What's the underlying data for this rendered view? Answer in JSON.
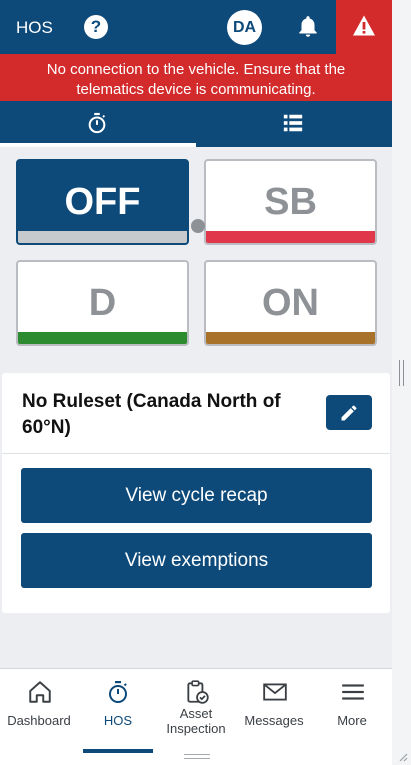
{
  "header": {
    "title": "HOS",
    "help_icon": "?",
    "avatar": "DA",
    "bell_icon": "bell-icon",
    "warning_icon": "warning-icon"
  },
  "alert": {
    "line1": "No connection to the vehicle. Ensure that the",
    "line2": "telematics device is communicating."
  },
  "tabs": [
    "stopwatch-icon",
    "list-icon"
  ],
  "statuses": [
    {
      "label": "OFF",
      "color": "#c7cacd",
      "active": true
    },
    {
      "label": "SB",
      "color": "#e0384a",
      "active": false
    },
    {
      "label": "D",
      "color": "#2c8a2f",
      "active": false
    },
    {
      "label": "ON",
      "color": "#a9722a",
      "active": false
    }
  ],
  "ruleset": {
    "line1": "No Ruleset (Canada North of",
    "line2": "60°N)"
  },
  "actions": {
    "cycle_recap": "View cycle recap",
    "exemptions": "View exemptions"
  },
  "nav": {
    "dashboard": "Dashboard",
    "hos": "HOS",
    "asset_inspection_1": "Asset",
    "asset_inspection_2": "Inspection",
    "messages": "Messages",
    "more": "More"
  },
  "colors": {
    "primary": "#0d4a7a",
    "alert": "#d32a2b"
  }
}
